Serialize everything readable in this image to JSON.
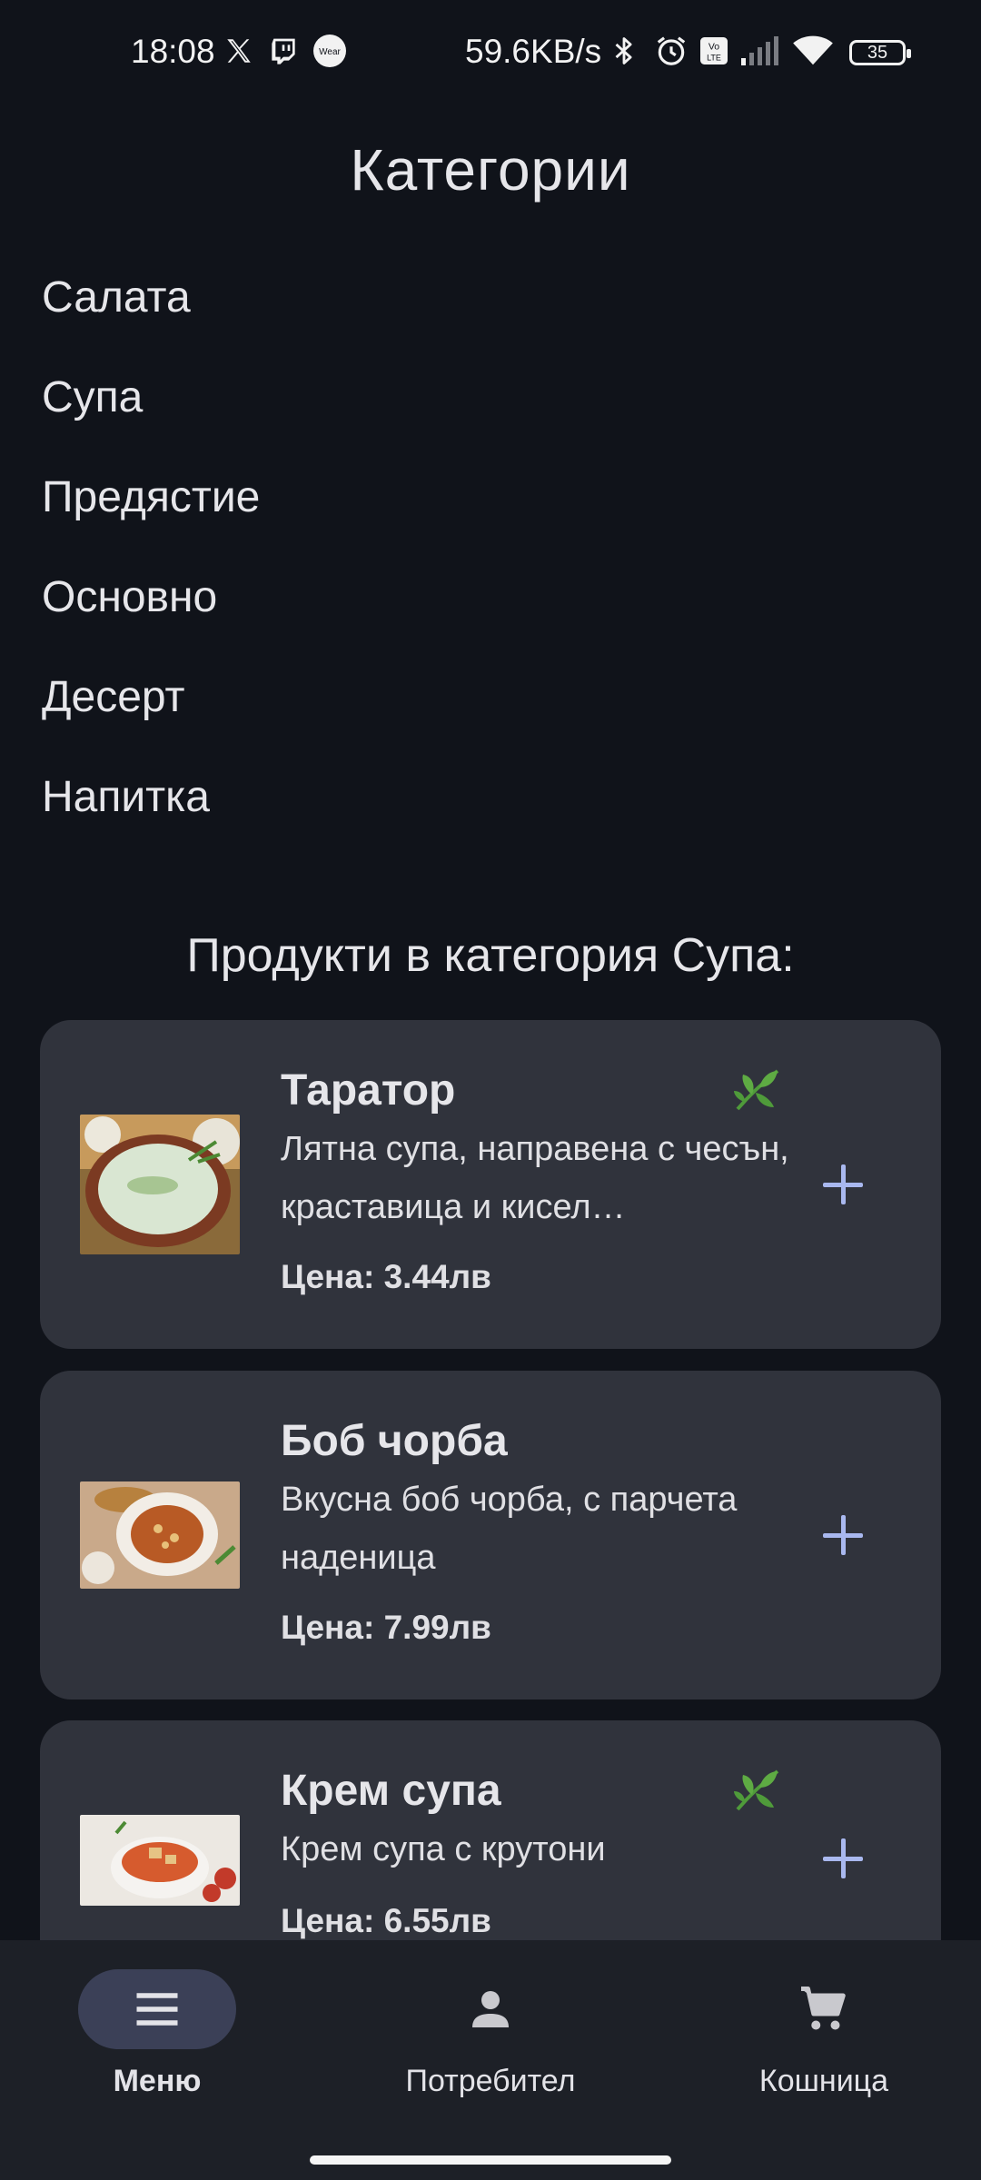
{
  "status_bar": {
    "time": "18:08",
    "network_speed": "59.6KB/s",
    "battery_level": "35",
    "wear_label": "Wear",
    "icons": [
      "x-icon",
      "twitch-icon",
      "wear-icon",
      "bluetooth-icon",
      "alarm-icon",
      "volte-icon",
      "signal-icon",
      "wifi-icon",
      "battery-icon"
    ]
  },
  "page": {
    "title": "Категории"
  },
  "categories": [
    {
      "label": "Салата"
    },
    {
      "label": "Супа"
    },
    {
      "label": "Предястие"
    },
    {
      "label": "Основно"
    },
    {
      "label": "Десерт"
    },
    {
      "label": "Напитка"
    }
  ],
  "products_section": {
    "title": "Продукти в категория Супа:"
  },
  "products": [
    {
      "name": "Таратор",
      "description": "Лятна супа, направена с чесън, краставица и кисел…",
      "price": "Цена: 3.44лв",
      "vegetarian": true
    },
    {
      "name": "Боб чорба",
      "description": "Вкусна боб чорба, с парчета наденица",
      "price": "Цена: 7.99лв",
      "vegetarian": false
    },
    {
      "name": "Крем супа",
      "description": "Крем супа с крутони",
      "price": "Цена: 6.55лв",
      "vegetarian": true
    }
  ],
  "bottom_nav": {
    "items": [
      {
        "label": "Меню",
        "icon": "menu-icon",
        "active": true
      },
      {
        "label": "Потребител",
        "icon": "person-icon",
        "active": false
      },
      {
        "label": "Кошница",
        "icon": "cart-icon",
        "active": false
      }
    ]
  },
  "colors": {
    "background": "#10131a",
    "card": "#30333c",
    "accent": "#a9b8ef",
    "nav_bar": "#1d2027",
    "nav_active_pill": "#3b4057",
    "leaf_green": "#4f9b3a"
  }
}
